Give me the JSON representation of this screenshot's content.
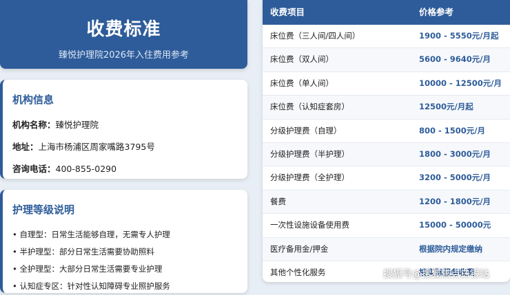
{
  "header": {
    "title": "收费标准",
    "subtitle": "臻悦护理院2026年入住费用参考"
  },
  "info": {
    "title": "机构信息",
    "name_key": "机构名称：",
    "name_val": "臻悦护理院",
    "addr_key": "地址：",
    "addr_val": "上海市杨浦区周家嘴路3795号",
    "phone_key": "咨询电话：",
    "phone_val": "400-855-0290"
  },
  "care": {
    "title": "护理等级说明",
    "items": [
      "• 自理型：日常生活能够自理，无需专人护理",
      "• 半护理型：部分日常生活需要协助照料",
      "• 全护理型：大部分日常生活需要专业护理",
      "• 认知症专区：针对性认知障碍专业照护服务"
    ]
  },
  "table": {
    "headers": [
      "收费项目",
      "价格参考"
    ],
    "rows": [
      [
        "床位费（三人间/四人间）",
        "1900 - 5550元/月起"
      ],
      [
        "床位费（双人间）",
        "5600 - 9640元/月"
      ],
      [
        "床位费（单人间）",
        "10000 - 12500元/月"
      ],
      [
        "床位费（认知症套房）",
        "12500元/月起"
      ],
      [
        "分级护理费（自理）",
        "800 - 1500元/月"
      ],
      [
        "分级护理费（半护理）",
        "1800 - 3000元/月"
      ],
      [
        "分级护理费（全护理）",
        "3200 - 5000元/月"
      ],
      [
        "餐费",
        "1200 - 1800元/月"
      ],
      [
        "一次性设施设备使用费",
        "15000 - 50000元"
      ],
      [
        "医疗备用金/押金",
        "根据院内规定缴纳"
      ],
      [
        "其他个性化服务",
        "按实际服务收费"
      ]
    ]
  },
  "watermark": "搜狐号@搜狐焦点白银站"
}
